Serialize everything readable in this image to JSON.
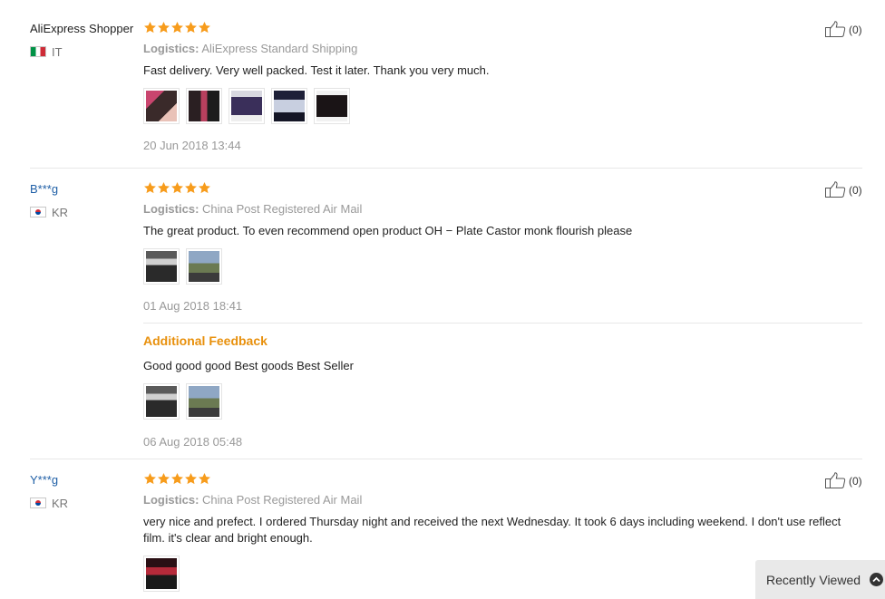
{
  "reviews": [
    {
      "user": "AliExpress Shopper",
      "country": "IT",
      "logistics_label": "Logistics:",
      "logistics": "AliExpress Standard Shipping",
      "text": "Fast delivery. Very well packed. Test it later. Thank you very much.",
      "date": "20 Jun 2018 13:44",
      "likes": "(0)",
      "rating": 5
    },
    {
      "user": "B***g",
      "country": "KR",
      "logistics_label": "Logistics:",
      "logistics": "China Post Registered Air Mail",
      "text": "The great product. To even recommend open product OH − Plate Castor monk flourish please",
      "date": "01 Aug 2018 18:41",
      "likes": "(0)",
      "rating": 5,
      "additional": {
        "label": "Additional Feedback",
        "text": "Good good good Best goods Best Seller",
        "date": "06 Aug 2018 05:48"
      }
    },
    {
      "user": "Y***g",
      "country": "KR",
      "logistics_label": "Logistics:",
      "logistics": "China Post Registered Air Mail",
      "text": "very nice and prefect. I ordered Thursday night and received the next Wednesday. It took 6 days including weekend. I don't use reflect film. it's clear and bright enough.",
      "likes": "(0)",
      "rating": 5
    }
  ],
  "recently_viewed": "Recently Viewed",
  "colors": {
    "star": "#f79c1c",
    "link": "#1f5fa6",
    "additional": "#e8900c"
  }
}
